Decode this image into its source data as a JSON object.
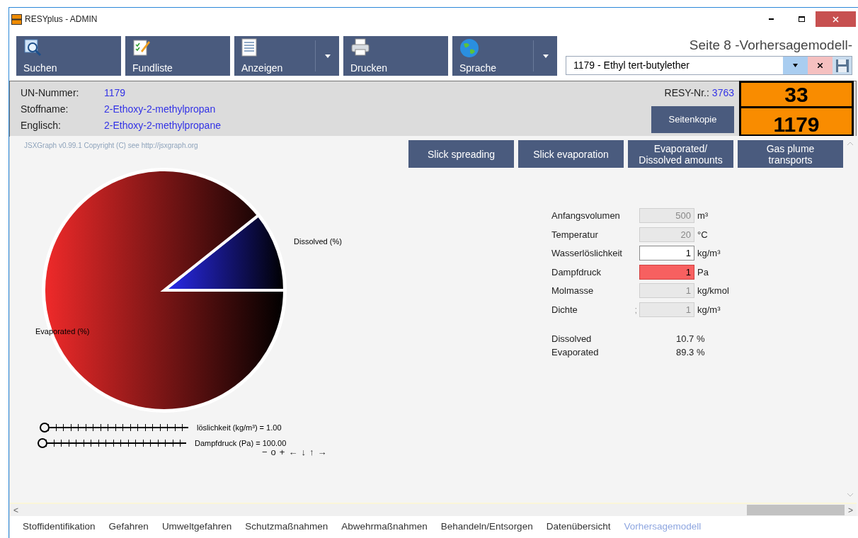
{
  "window": {
    "title": "RESYplus - ADMIN"
  },
  "toolbar": [
    {
      "label": "Suchen",
      "has_menu": false
    },
    {
      "label": "Fundliste",
      "has_menu": false
    },
    {
      "label": "Anzeigen",
      "has_menu": true
    },
    {
      "label": "Drucken",
      "has_menu": false
    },
    {
      "label": "Sprache",
      "has_menu": true
    }
  ],
  "page_title": "Seite 8 -Vorhersagemodell-",
  "substance_select": {
    "value": "1179 - Ethyl tert-butylether"
  },
  "info": {
    "rows": [
      {
        "label": "UN-Nummer:",
        "value": "1179"
      },
      {
        "label": "Stoffname:",
        "value": "2-Ethoxy-2-methylpropan"
      },
      {
        "label": "Englisch:",
        "value": "2-Ethoxy-2-methylpropane"
      }
    ],
    "resy_label": "RESY-Nr.:",
    "resy_value": "3763",
    "copy_button": "Seitenkopie",
    "hazard_number": "33",
    "un_number": "1179"
  },
  "credit": "JSXGraph v0.99.1 Copyright (C) see http://jsxgraph.org",
  "model_buttons": [
    {
      "lines": [
        "Slick spreading"
      ]
    },
    {
      "lines": [
        "Slick evaporation"
      ]
    },
    {
      "lines": [
        "Evaporated/",
        "Dissolved amounts"
      ]
    },
    {
      "lines": [
        "Gas plume",
        "transports"
      ]
    }
  ],
  "chart_data": {
    "type": "pie",
    "categories": [
      "Dissolved (%)",
      "Evaporated (%)"
    ],
    "values": [
      10.7,
      89.3
    ]
  },
  "sliders": [
    {
      "label": "löslichkeit (kg/m³) = 1.00",
      "level": 0
    },
    {
      "label": "Dampfdruck (Pa) = 100.00",
      "level": 0
    }
  ],
  "nav_controls": [
    "−",
    "o",
    "+",
    "←",
    "↓",
    "↑",
    "→"
  ],
  "parameters": [
    {
      "label": "Anfangsvolumen",
      "value": "500",
      "unit": "m³",
      "kind": "readonly"
    },
    {
      "label": "Temperatur",
      "value": "20",
      "unit": "°C",
      "kind": "readonly"
    },
    {
      "label": "Wasserlöslichkeit",
      "value": "1",
      "unit": "kg/m³",
      "kind": "input"
    },
    {
      "label": "Dampfdruck",
      "value": "1",
      "unit": "Pa",
      "kind": "alert"
    },
    {
      "label": "Molmasse",
      "value": "1",
      "unit": "kg/kmol",
      "kind": "readonly"
    },
    {
      "label": "Dichte",
      "prefix": ";",
      "value": "1",
      "unit": "kg/m³",
      "kind": "readonly"
    }
  ],
  "results": [
    {
      "label": "Dissolved",
      "value": "10.7 %"
    },
    {
      "label": "Evaporated",
      "value": "89.3 %"
    }
  ],
  "scroll_left": "<",
  "scroll_right": ">",
  "tabs": [
    {
      "label": "Stoffidentifikation",
      "selected": false
    },
    {
      "label": "Gefahren",
      "selected": false
    },
    {
      "label": "Umweltgefahren",
      "selected": false
    },
    {
      "label": "Schutzmaßnahmen",
      "selected": false
    },
    {
      "label": "Abwehrmaßnahmen",
      "selected": false
    },
    {
      "label": "Behandeln/Entsorgen",
      "selected": false
    },
    {
      "label": "Datenübersicht",
      "selected": false
    },
    {
      "label": "Vorhersagemodell",
      "selected": true
    }
  ]
}
